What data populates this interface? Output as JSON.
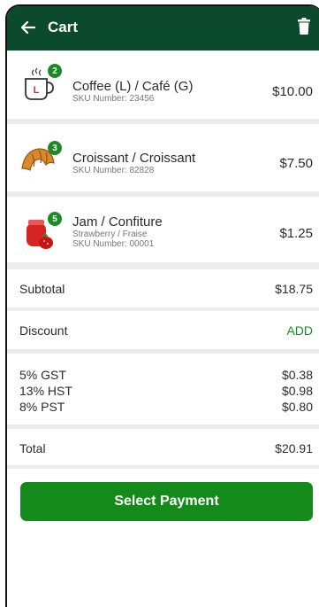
{
  "header": {
    "title": "Cart",
    "bg_color": "#0b4a2c"
  },
  "items": [
    {
      "icon": "coffee-cup-icon",
      "quantity": "2",
      "name": "Coffee (L) / Café (G)",
      "variant": "",
      "sku": "SKU Number: 23456",
      "price": "$10.00"
    },
    {
      "icon": "croissant-icon",
      "quantity": "3",
      "name": "Croissant / Croissant",
      "variant": "",
      "sku": "SKU Number: 82828",
      "price": "$7.50"
    },
    {
      "icon": "jam-jar-icon",
      "quantity": "5",
      "name": "Jam / Confiture",
      "variant": "Strawberry / Fraise",
      "sku": "SKU Number: 00001",
      "price": "$1.25"
    }
  ],
  "summary": {
    "subtotal_label": "Subtotal",
    "subtotal_value": "$18.75",
    "discount_label": "Discount",
    "discount_action": "ADD",
    "taxes": [
      {
        "label": "5% GST",
        "value": "$0.38"
      },
      {
        "label": "13% HST",
        "value": "$0.98"
      },
      {
        "label": "8% PST",
        "value": "$0.80"
      }
    ],
    "total_label": "Total",
    "total_value": "$20.91"
  },
  "actions": {
    "pay_label": "Select Payment",
    "accent_color": "#148a1b"
  }
}
